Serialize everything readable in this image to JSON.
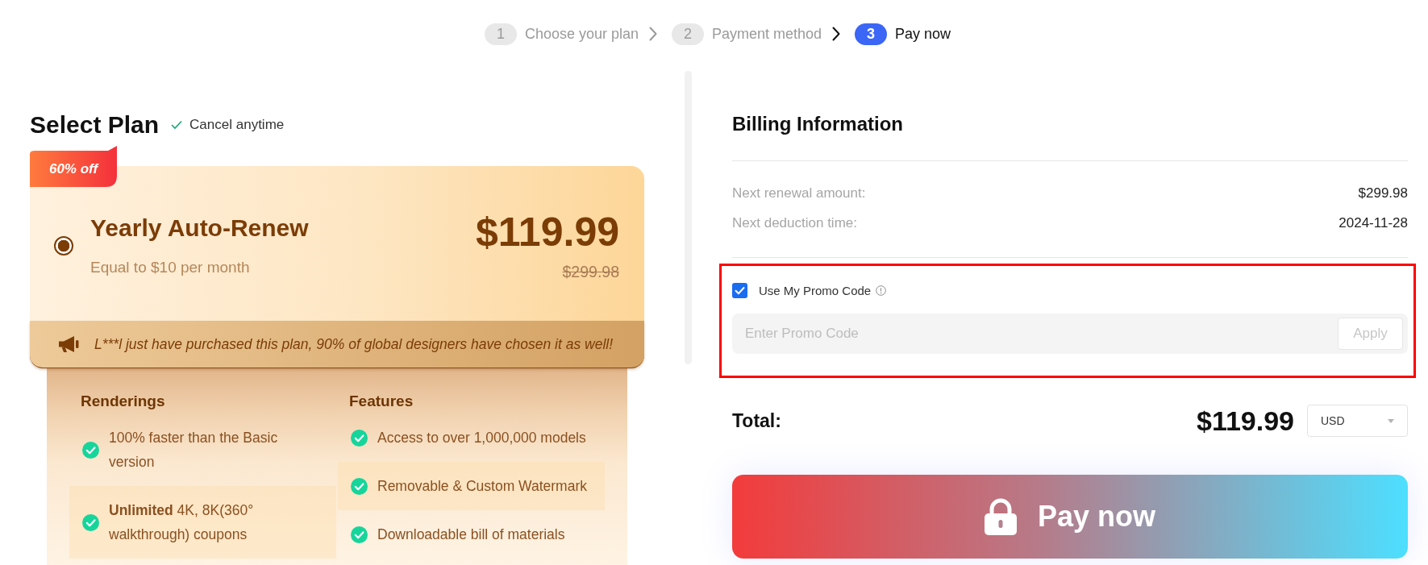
{
  "steps": [
    {
      "number": "1",
      "label": "Choose your plan",
      "selected": false
    },
    {
      "number": "2",
      "label": "Payment method",
      "selected": false
    },
    {
      "number": "3",
      "label": "Pay now",
      "selected": true
    }
  ],
  "plan_section": {
    "title": "Select Plan",
    "note": "Cancel anytime"
  },
  "plan_card": {
    "badge": "60% off",
    "selected": true,
    "name": "Yearly Auto-Renew",
    "subtitle": "Equal to $10 per month",
    "price": "$119.99",
    "original_price": "$299.98",
    "notice": "L***l just have purchased this plan, 90% of global designers have chosen it as well!"
  },
  "features": {
    "columns": [
      {
        "title": "Renderings",
        "items": [
          "100% faster than the Basic version",
          "**Unlimited** 4K, 8K(360° walkthrough) coupons"
        ]
      },
      {
        "title": "Features",
        "items": [
          "Access to over 1,000,000 models",
          "Removable & Custom Watermark",
          "Downloadable bill of materials"
        ]
      }
    ]
  },
  "billing": {
    "title": "Billing Information",
    "rows": [
      {
        "label": "Next renewal amount:",
        "value": "$299.98"
      },
      {
        "label": "Next deduction time:",
        "value": "2024-11-28"
      }
    ]
  },
  "promo": {
    "highlighted": true,
    "checked": true,
    "label": "Use My Promo Code",
    "placeholder": "Enter Promo Code",
    "apply": {
      "label": "Apply",
      "disabled": true
    }
  },
  "total": {
    "label": "Total:",
    "amount": "$119.99",
    "currency": "USD"
  },
  "pay_button": {
    "label": "Pay now"
  }
}
